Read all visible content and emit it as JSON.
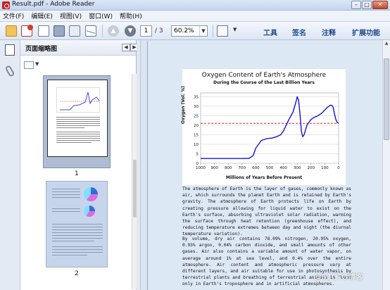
{
  "window": {
    "title": "Result.pdf - Adobe Reader",
    "controls": [
      "–",
      "□",
      "✕"
    ]
  },
  "menu": [
    "文件(F)",
    "编辑(E)",
    "视图(V)",
    "窗口(W)",
    "帮助(H)"
  ],
  "toolbar": {
    "page_current": "1",
    "page_total": "/ 3",
    "zoom": "60.2%",
    "tools_label": "工具",
    "sign_label": "签名",
    "comment_label": "注释",
    "extended_label": "扩展功能"
  },
  "thumbnail_panel": {
    "title": "页面缩略图",
    "pages": [
      {
        "label": "1"
      },
      {
        "label": "2"
      }
    ]
  },
  "document": {
    "chart_data": {
      "type": "line",
      "title": "Oxygen Content of Earth's Atmosphere",
      "subtitle": "During the Course of the Last Billion Years",
      "xlabel": "Millions of Years Before Present",
      "ylabel": "Oxygen (Vol. %)",
      "x_ticks": [
        "1000",
        "900",
        "800",
        "700",
        "600",
        "500",
        "400",
        "300",
        "200",
        "100",
        "0"
      ],
      "y_ticks": [
        "0",
        "5",
        "10",
        "15",
        "20",
        "25",
        "30",
        "35"
      ],
      "xlim": [
        1000,
        0
      ],
      "ylim": [
        0,
        37
      ],
      "grid": true,
      "series": [
        {
          "color": "#1414d6",
          "x": [
            1000,
            900,
            800,
            700,
            650,
            620,
            600,
            560,
            520,
            480,
            450,
            420,
            400,
            380,
            360,
            330,
            310,
            300,
            290,
            280,
            270,
            260,
            250,
            230,
            200,
            180,
            150,
            120,
            100,
            80,
            60,
            50,
            40,
            30,
            20,
            10,
            0
          ],
          "y": [
            2.5,
            2.5,
            2.5,
            2.5,
            2.6,
            4,
            8,
            12,
            13,
            13.3,
            14,
            15,
            17,
            20,
            23,
            27,
            32,
            35,
            33,
            26,
            17,
            14,
            15,
            20,
            23,
            24,
            25,
            26.5,
            28,
            29.5,
            30.5,
            30.5,
            29.5,
            26,
            23,
            21.5,
            21
          ]
        }
      ],
      "reference_line": {
        "y": 21,
        "color": "#e02020",
        "style": "dashed"
      }
    },
    "paragraph1": "The atmosphere of Earth is the layer of gases, commonly known as air, which surrounds the planet Earth and is retained by Earth's gravity. The atmosphere of Earth protects life on Earth by creating pressure allowing for liquid water to exist on the Earth's surface, absorbing ultraviolet solar radiation, warming the surface through heat retention (greenhouse effect), and reducing temperature extremes between day and night (the diurnal temperature variation).",
    "paragraph2": "By volume, dry air contains 78.09% nitrogen, 20.95% oxygen, 0.93% argon, 0.04% carbon dioxide, and small amounts of other gases. Air also contains a variable amount of water vapor, on average around 1% at sea level, and 0.4% over the entire atmosphere. Air content and atmospheric pressure vary at different layers, and air suitable for use in photosynthesis by terrestrial plants and breathing of terrestrial animals is found only in Earth's troposphere and in artificial atmospheres."
  },
  "watermark": "@51CTO博客",
  "colors": {
    "accent": "#1f4b8f",
    "series": "#1414d6",
    "reference": "#e02020"
  }
}
